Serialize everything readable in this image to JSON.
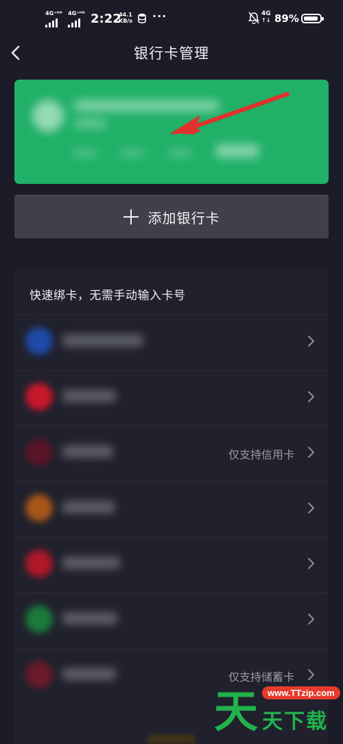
{
  "status_bar": {
    "net1": "4G⁺ᴴᴰ",
    "net2": "4G⁺ᴴᴰ",
    "time": "2:22",
    "speed_value": "44.1",
    "speed_unit": "KB/s",
    "more": "···",
    "net3": "4G",
    "battery_pct": "89%",
    "battery_level": 0.89
  },
  "nav": {
    "back_icon": "chevron-left-icon",
    "title": "银行卡管理"
  },
  "card": {
    "color": "#20b067",
    "arrow_color": "#e0322b"
  },
  "add_button": {
    "label": "添加银行卡"
  },
  "quick_bind": {
    "title": "快速绑卡，无需手动输入卡号",
    "banks": [
      {
        "icon_color": "#1e4aa8",
        "note": ""
      },
      {
        "icon_color": "#c8182b",
        "note": ""
      },
      {
        "icon_color": "#5a1428",
        "note": "仅支持信用卡"
      },
      {
        "icon_color": "#a8561a",
        "note": ""
      },
      {
        "icon_color": "#b01828",
        "note": ""
      },
      {
        "icon_color": "#1c7a3c",
        "note": ""
      },
      {
        "icon_color": "#6a1a2a",
        "note": "仅支持储蓄卡"
      }
    ]
  },
  "watermark": {
    "url": "www.TTzip.com",
    "big_char": "天",
    "text": "天下载"
  }
}
